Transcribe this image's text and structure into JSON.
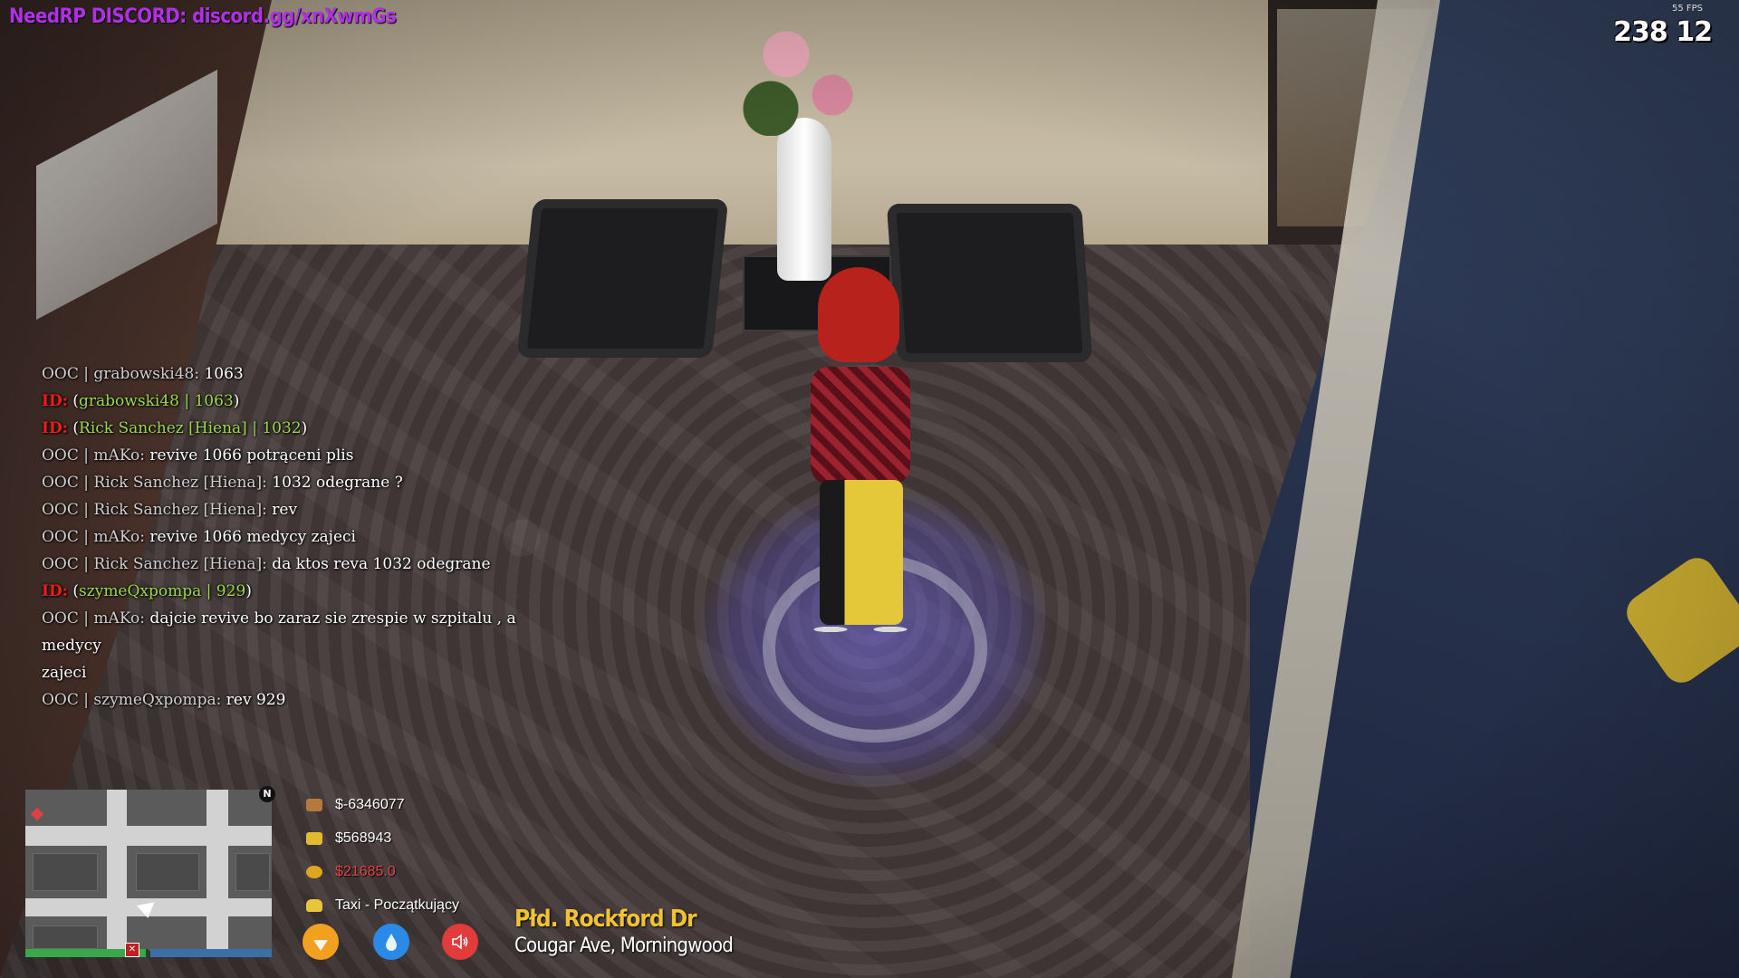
{
  "hud": {
    "discord": "NeedRP DISCORD: discord.gg/xnXwmGs",
    "fps": "55 FPS",
    "clock": "238 12"
  },
  "chat": [
    {
      "prefix": "OOC | grabowski48:",
      "text": " 1063"
    },
    {
      "idtag": "ID:",
      "open": " (",
      "name": "grabowski48 | 1063",
      "close": ")"
    },
    {
      "idtag": "ID:",
      "open": " (",
      "name": "Rick Sanchez [Hiena] | 1032",
      "close": ")"
    },
    {
      "prefix": "OOC | mAKo:",
      "text": " revive 1066 potrąceni plis"
    },
    {
      "prefix": "OOC | Rick Sanchez [Hiena]:",
      "text": " 1032 odegrane ?"
    },
    {
      "prefix": "OOC | Rick Sanchez [Hiena]:",
      "text": " rev"
    },
    {
      "prefix": "OOC | mAKo:",
      "text": " revive 1066 medycy zajeci"
    },
    {
      "prefix": "OOC | Rick Sanchez [Hiena]:",
      "text": " da ktos reva 1032 odegrane"
    },
    {
      "idtag": "ID:",
      "open": " (",
      "name": "szymeQxpompa | 929",
      "close": ")"
    },
    {
      "prefix": "OOC | mAKo:",
      "text": " dajcie revive bo zaraz sie zrespie w szpitalu , a medycy"
    },
    {
      "prefix": "",
      "text": "zajeci"
    },
    {
      "prefix": "OOC | szymeQxpompa:",
      "text": " rev 929"
    }
  ],
  "minimap": {
    "north": "N",
    "health_fraction": 0.98,
    "armor_fraction": 1.0
  },
  "money": {
    "bank_icon": "bag-icon",
    "bank": "$-6346077",
    "card_icon": "card-icon",
    "card": "$568943",
    "dirty_icon": "money-bag-icon",
    "dirty": "$21685.0",
    "job_icon": "taxi-icon",
    "job": "Taxi - Początkujący"
  },
  "buttons": [
    {
      "icon": "food-icon",
      "color": "#f2a020"
    },
    {
      "icon": "water-icon",
      "color": "#2a8ae8"
    },
    {
      "icon": "speaker-icon",
      "color": "#e23b3b"
    }
  ],
  "location": {
    "street": "Płd. Rockford Dr",
    "area": "Cougar Ave, Morningwood"
  }
}
